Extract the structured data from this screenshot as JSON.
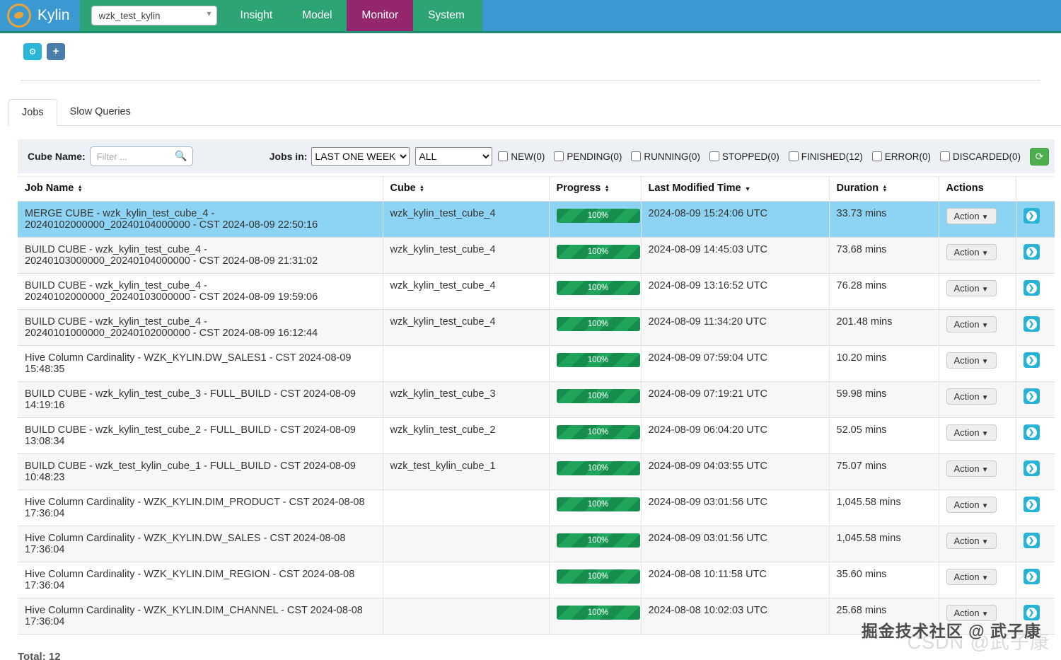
{
  "navbar": {
    "brand": "Kylin",
    "project_select": {
      "value": "wzk_test_kylin"
    },
    "menu": [
      {
        "label": "Insight",
        "active": false
      },
      {
        "label": "Model",
        "active": false
      },
      {
        "label": "Monitor",
        "active": true
      },
      {
        "label": "System",
        "active": false
      }
    ]
  },
  "toolbar": {
    "cogs_icon": "⚙",
    "plus_icon": "+"
  },
  "tabs": [
    {
      "label": "Jobs",
      "active": true
    },
    {
      "label": "Slow Queries",
      "active": false
    }
  ],
  "filter": {
    "cube_name_label": "Cube Name:",
    "filter_placeholder": "Filter ...",
    "jobs_in_label": "Jobs in:",
    "time_range_value": "LAST ONE WEEK",
    "scope_value": "ALL",
    "statuses": [
      {
        "label": "NEW(0)",
        "checked": false
      },
      {
        "label": "PENDING(0)",
        "checked": false
      },
      {
        "label": "RUNNING(0)",
        "checked": false
      },
      {
        "label": "STOPPED(0)",
        "checked": false
      },
      {
        "label": "FINISHED(12)",
        "checked": false
      },
      {
        "label": "ERROR(0)",
        "checked": false
      },
      {
        "label": "DISCARDED(0)",
        "checked": false
      }
    ]
  },
  "table": {
    "columns": [
      "Job Name",
      "Cube",
      "Progress",
      "Last Modified Time",
      "Duration",
      "Actions"
    ],
    "action_label": "Action",
    "rows": [
      {
        "job_name": "MERGE CUBE - wzk_kylin_test_cube_4 - 20240102000000_20240104000000 - CST 2024-08-09 22:50:16",
        "cube": "wzk_kylin_test_cube_4",
        "progress": "100%",
        "last_modified": "2024-08-09 15:24:06 UTC",
        "duration": "33.73 mins",
        "highlighted": true
      },
      {
        "job_name": "BUILD CUBE - wzk_kylin_test_cube_4 - 20240103000000_20240104000000 - CST 2024-08-09 21:31:02",
        "cube": "wzk_kylin_test_cube_4",
        "progress": "100%",
        "last_modified": "2024-08-09 14:45:03 UTC",
        "duration": "73.68 mins",
        "highlighted": false
      },
      {
        "job_name": "BUILD CUBE - wzk_kylin_test_cube_4 - 20240102000000_20240103000000 - CST 2024-08-09 19:59:06",
        "cube": "wzk_kylin_test_cube_4",
        "progress": "100%",
        "last_modified": "2024-08-09 13:16:52 UTC",
        "duration": "76.28 mins",
        "highlighted": false
      },
      {
        "job_name": "BUILD CUBE - wzk_kylin_test_cube_4 - 20240101000000_20240102000000 - CST 2024-08-09 16:12:44",
        "cube": "wzk_kylin_test_cube_4",
        "progress": "100%",
        "last_modified": "2024-08-09 11:34:20 UTC",
        "duration": "201.48 mins",
        "highlighted": false
      },
      {
        "job_name": "Hive Column Cardinality - WZK_KYLIN.DW_SALES1 - CST 2024-08-09 15:48:35",
        "cube": "",
        "progress": "100%",
        "last_modified": "2024-08-09 07:59:04 UTC",
        "duration": "10.20 mins",
        "highlighted": false
      },
      {
        "job_name": "BUILD CUBE - wzk_kylin_test_cube_3 - FULL_BUILD - CST 2024-08-09 14:19:16",
        "cube": "wzk_kylin_test_cube_3",
        "progress": "100%",
        "last_modified": "2024-08-09 07:19:21 UTC",
        "duration": "59.98 mins",
        "highlighted": false
      },
      {
        "job_name": "BUILD CUBE - wzk_kylin_test_cube_2 - FULL_BUILD - CST 2024-08-09 13:08:34",
        "cube": "wzk_kylin_test_cube_2",
        "progress": "100%",
        "last_modified": "2024-08-09 06:04:20 UTC",
        "duration": "52.05 mins",
        "highlighted": false
      },
      {
        "job_name": "BUILD CUBE - wzk_test_kylin_cube_1 - FULL_BUILD - CST 2024-08-09 10:48:23",
        "cube": "wzk_test_kylin_cube_1",
        "progress": "100%",
        "last_modified": "2024-08-09 04:03:55 UTC",
        "duration": "75.07 mins",
        "highlighted": false
      },
      {
        "job_name": "Hive Column Cardinality - WZK_KYLIN.DIM_PRODUCT - CST 2024-08-08 17:36:04",
        "cube": "",
        "progress": "100%",
        "last_modified": "2024-08-09 03:01:56 UTC",
        "duration": "1,045.58 mins",
        "highlighted": false
      },
      {
        "job_name": "Hive Column Cardinality - WZK_KYLIN.DW_SALES - CST 2024-08-08 17:36:04",
        "cube": "",
        "progress": "100%",
        "last_modified": "2024-08-09 03:01:56 UTC",
        "duration": "1,045.58 mins",
        "highlighted": false
      },
      {
        "job_name": "Hive Column Cardinality - WZK_KYLIN.DIM_REGION - CST 2024-08-08 17:36:04",
        "cube": "",
        "progress": "100%",
        "last_modified": "2024-08-08 10:11:58 UTC",
        "duration": "35.60 mins",
        "highlighted": false
      },
      {
        "job_name": "Hive Column Cardinality - WZK_KYLIN.DIM_CHANNEL - CST 2024-08-08 17:36:04",
        "cube": "",
        "progress": "100%",
        "last_modified": "2024-08-08 10:02:03 UTC",
        "duration": "25.68 mins",
        "highlighted": false
      }
    ]
  },
  "footer": {
    "total": "Total: 12"
  },
  "watermarks": {
    "primary": "掘金技术社区 @ 武子康",
    "secondary": "CSDN @武子康"
  },
  "colors": {
    "navbar_blue": "#3a99d1",
    "navbar_green": "#2ca474",
    "active_menu_purple": "#93266d",
    "highlight_row_blue": "#8dd3f3",
    "progress_green": "#1ea55b",
    "refresh_green": "#4cae4c",
    "go_button_cyan": "#27b3d6"
  }
}
